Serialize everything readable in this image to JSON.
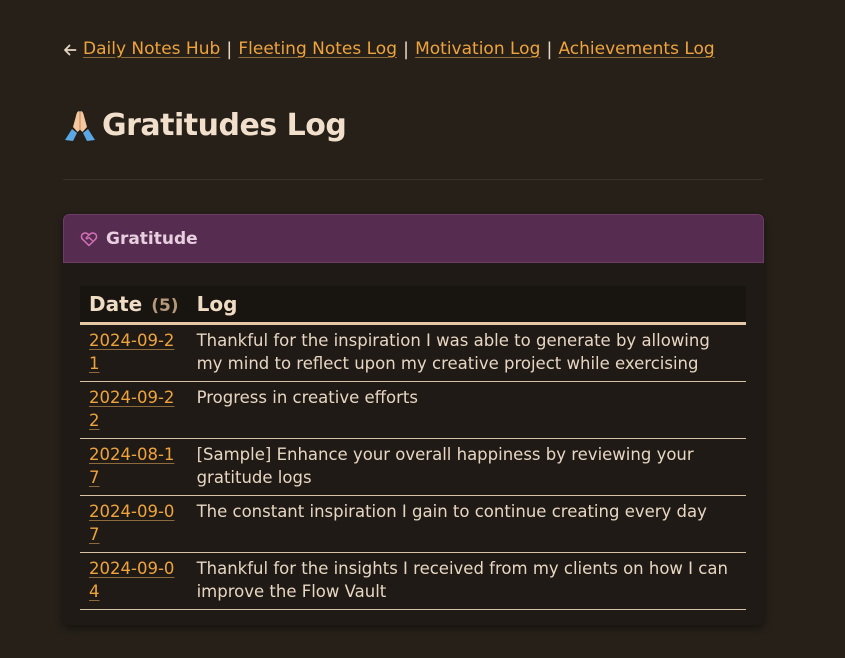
{
  "nav": {
    "links": [
      "Daily Notes Hub",
      "Fleeting Notes Log",
      "Motivation Log",
      "Achievements Log"
    ],
    "separator": "|"
  },
  "page": {
    "title": "Gratitudes Log",
    "emoji": "🙏"
  },
  "card": {
    "title": "Gratitude",
    "icon": "heart-handshake-icon"
  },
  "table": {
    "headers": {
      "date": "Date",
      "count": "(5)",
      "log": "Log"
    },
    "rows": [
      {
        "date": "2024-09-21",
        "log": "Thankful for the inspiration I was able to generate by allowing my mind to reflect upon my creative project while exercising"
      },
      {
        "date": "2024-09-22",
        "log": "Progress in creative efforts"
      },
      {
        "date": "2024-08-17",
        "log": "[Sample] Enhance your overall happiness by reviewing your gratitude logs"
      },
      {
        "date": "2024-09-07",
        "log": "The constant inspiration I gain to continue creating every day"
      },
      {
        "date": "2024-09-04",
        "log": "Thankful for the insights I received from my clients on how I can improve the Flow Vault"
      }
    ]
  },
  "colors": {
    "background": "#262019",
    "link": "#eea33d",
    "card_header": "#562c50",
    "text": "#e7d6c2"
  }
}
